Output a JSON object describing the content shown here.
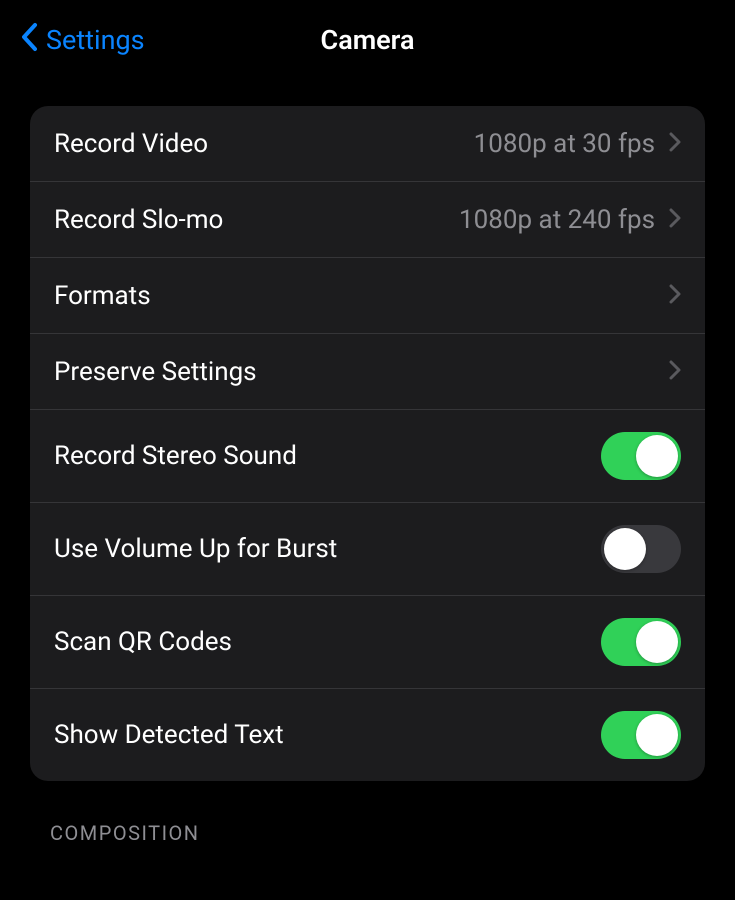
{
  "nav": {
    "back_label": "Settings",
    "title": "Camera"
  },
  "rows": [
    {
      "label": "Record Video",
      "value": "1080p at 30 fps",
      "type": "nav"
    },
    {
      "label": "Record Slo-mo",
      "value": "1080p at 240 fps",
      "type": "nav"
    },
    {
      "label": "Formats",
      "value": "",
      "type": "nav"
    },
    {
      "label": "Preserve Settings",
      "value": "",
      "type": "nav"
    },
    {
      "label": "Record Stereo Sound",
      "type": "toggle",
      "on": true
    },
    {
      "label": "Use Volume Up for Burst",
      "type": "toggle",
      "on": false
    },
    {
      "label": "Scan QR Codes",
      "type": "toggle",
      "on": true
    },
    {
      "label": "Show Detected Text",
      "type": "toggle",
      "on": true
    }
  ],
  "next_section_label": "COMPOSITION"
}
